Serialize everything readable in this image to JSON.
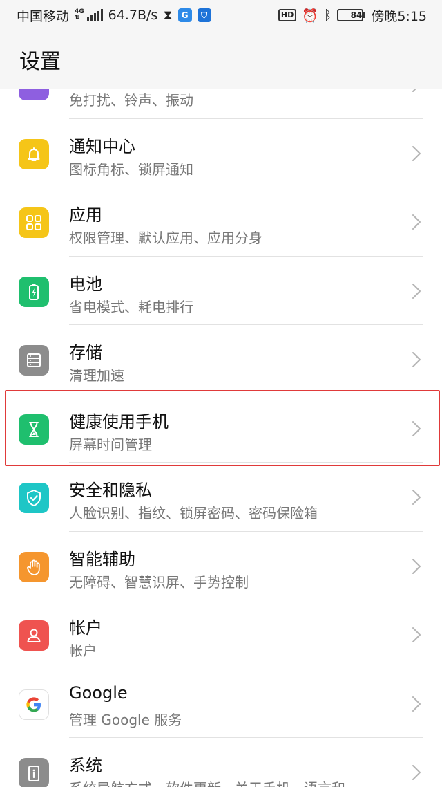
{
  "status": {
    "carrier": "中国移动",
    "net_type": "4G",
    "speed": "64.7B/s",
    "hd": "HD",
    "battery": "84",
    "time": "傍晚5:15"
  },
  "header": {
    "title": "设置"
  },
  "settings": [
    {
      "label": "",
      "sub": "免打扰、铃声、振动",
      "icon": "sound-icon",
      "color": "#8e5fe0"
    },
    {
      "label": "通知中心",
      "sub": "图标角标、锁屏通知",
      "icon": "bell-icon",
      "color": "#f5c518"
    },
    {
      "label": "应用",
      "sub": "权限管理、默认应用、应用分身",
      "icon": "apps-grid-icon",
      "color": "#f5c518"
    },
    {
      "label": "电池",
      "sub": "省电模式、耗电排行",
      "icon": "battery-icon",
      "color": "#1fbf6e"
    },
    {
      "label": "存储",
      "sub": "清理加速",
      "icon": "storage-icon",
      "color": "#8c8c8c"
    },
    {
      "label": "健康使用手机",
      "sub": "屏幕时间管理",
      "icon": "hourglass-icon",
      "color": "#1fbf6e"
    },
    {
      "label": "安全和隐私",
      "sub": "人脸识别、指纹、锁屏密码、密码保险箱",
      "icon": "shield-icon",
      "color": "#1ec6c6"
    },
    {
      "label": "智能辅助",
      "sub": "无障碍、智慧识屏、手势控制",
      "icon": "hand-icon",
      "color": "#f5962e"
    },
    {
      "label": "帐户",
      "sub": "帐户",
      "icon": "account-icon",
      "color": "#ef5350"
    },
    {
      "label": "Google",
      "sub": "管理 Google 服务",
      "icon": "google-icon",
      "color": "#ffffff"
    },
    {
      "label": "系统",
      "sub": "系统导航方式、软件更新、关于手机、语言和",
      "icon": "system-info-icon",
      "color": "#8c8c8c"
    }
  ]
}
